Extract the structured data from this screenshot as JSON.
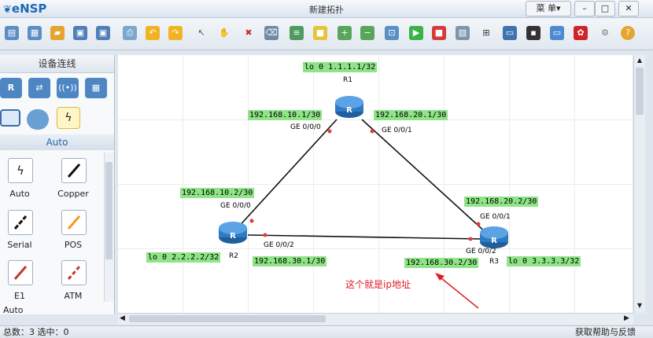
{
  "app": {
    "logo": "eNSP",
    "title": "新建拓扑",
    "menu_label": "菜 单▾"
  },
  "window_controls": {
    "minimize": "–",
    "maximize": "□",
    "close": "✕"
  },
  "toolbar": {
    "icons": [
      "new-topology-icon",
      "new-example-icon",
      "open-icon",
      "save-icon",
      "save-as-icon",
      "print-icon",
      "undo-icon",
      "redo-icon",
      "select-icon",
      "pan-hand-icon",
      "delete-icon",
      "delete-link-icon",
      "text-icon",
      "palette-icon",
      "zoom-in-icon",
      "zoom-out-icon",
      "fit-icon",
      "start-device-icon",
      "stop-device-icon",
      "capture-icon",
      "topology-icon",
      "console-icon",
      "command-line-icon",
      "chat-icon",
      "huawei-icon",
      "settings-icon",
      "help-icon"
    ]
  },
  "left_panel": {
    "header": "设备连线",
    "devices": [
      "router-icon",
      "switch-icon",
      "wlan-icon",
      "firewall-icon",
      "pc-icon",
      "cloud-icon",
      "connection-icon"
    ],
    "sub_header": "Auto",
    "cables": [
      {
        "label": "Auto",
        "icon": "auto-cable-icon"
      },
      {
        "label": "Copper",
        "icon": "copper-cable-icon"
      },
      {
        "label": "Serial",
        "icon": "serial-cable-icon"
      },
      {
        "label": "POS",
        "icon": "pos-cable-icon"
      },
      {
        "label": "E1",
        "icon": "e1-cable-icon"
      },
      {
        "label": "ATM",
        "icon": "atm-cable-icon"
      }
    ],
    "footer_label": "Auto"
  },
  "topology": {
    "routers": [
      {
        "name": "R1",
        "loopback": "lo 0 1.1.1.1/32"
      },
      {
        "name": "R2",
        "loopback": "lo 0 2.2.2.2/32"
      },
      {
        "name": "R3",
        "loopback": "lo 0 3.3.3.3/32"
      }
    ],
    "links": [
      {
        "a_ip": "192.168.10.1/30",
        "a_port": "GE 0/0/0",
        "b_ip": "192.168.10.2/30",
        "b_port": "GE 0/0/0"
      },
      {
        "a_ip": "192.168.20.1/30",
        "a_port": "GE 0/0/1",
        "b_ip": "192.168.20.2/30",
        "b_port": "GE 0/0/1"
      },
      {
        "a_ip": "192.168.30.1/30",
        "a_port": "GE 0/0/2",
        "b_ip": "192.168.30.2/30",
        "b_port": "GE 0/0/2"
      }
    ],
    "annotation": "这个就是ip地址"
  },
  "status": {
    "left": "总数：3 选中：0",
    "right": "获取帮助与反馈"
  }
}
